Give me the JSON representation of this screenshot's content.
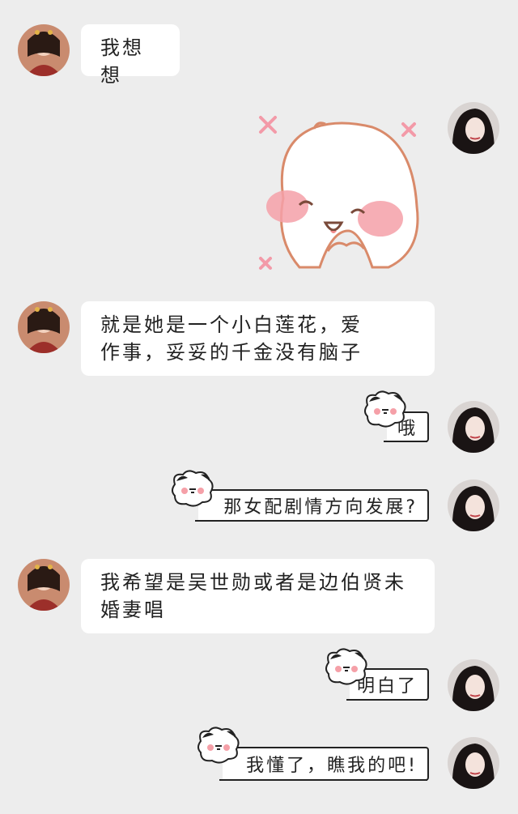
{
  "messages": [
    {
      "side": "left",
      "text": "我想想"
    },
    {
      "side": "right",
      "kind": "sticker",
      "sticker": "cute-bunny-blushing"
    },
    {
      "side": "left",
      "text": "就是她是一个小白莲花，爱作事，妥妥的千金没有脑子"
    },
    {
      "side": "right",
      "text": "哦"
    },
    {
      "side": "right",
      "text": "那女配剧情方向发展?"
    },
    {
      "side": "left",
      "text": "我希望是吴世勋或者是边伯贤未婚妻唱"
    },
    {
      "side": "right",
      "text": "明白了"
    },
    {
      "side": "right",
      "text": "我懂了，瞧我的吧!"
    }
  ],
  "colors": {
    "background": "#ededed",
    "bubble": "#ffffff",
    "text": "#222222"
  }
}
